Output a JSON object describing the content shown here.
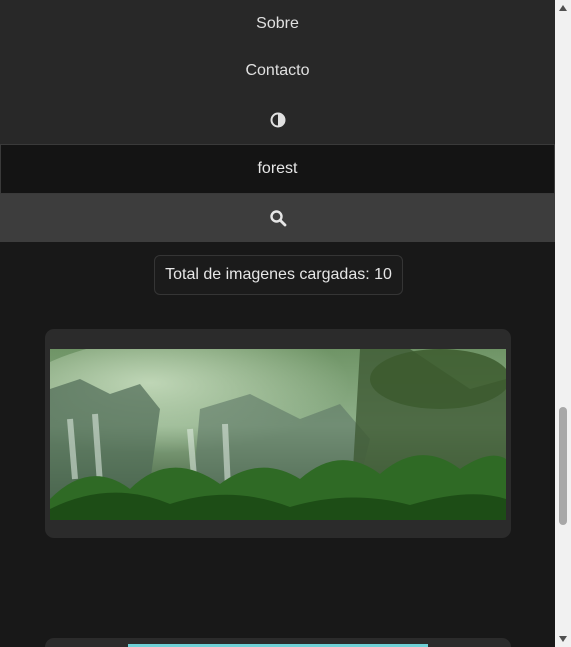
{
  "nav": {
    "about_label": "Sobre",
    "contact_label": "Contacto",
    "theme_icon": "contrast-icon"
  },
  "search": {
    "value": "forest",
    "button_icon": "search-icon"
  },
  "counter": {
    "text": "Total de imagenes cargadas: 10"
  },
  "cards": [
    {
      "image": "forest-waterfall-image"
    },
    {
      "image": "image-thumbnail"
    }
  ],
  "colors": {
    "background": "#181818",
    "nav_background": "#282828",
    "search_button": "#3d3d3d",
    "card_background": "#2b2b2b"
  }
}
